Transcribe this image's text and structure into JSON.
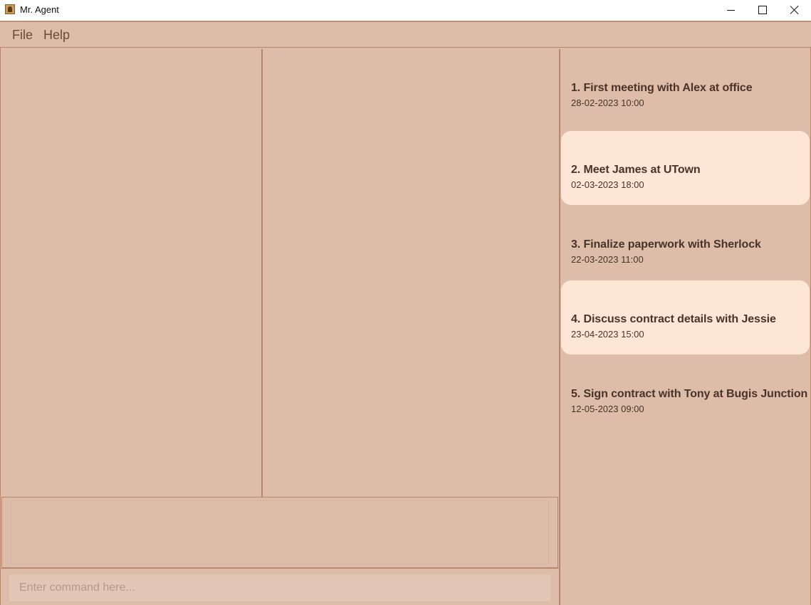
{
  "window": {
    "title": "Mr. Agent",
    "controls": [
      "minimize",
      "maximize",
      "close"
    ]
  },
  "menu": {
    "items": [
      {
        "label": "File"
      },
      {
        "label": "Help"
      }
    ]
  },
  "command_box": {
    "placeholder": "Enter command here...",
    "value": ""
  },
  "result_display": {
    "text": ""
  },
  "events": [
    {
      "title": "1. First meeting with Alex at office",
      "datetime": "28-02-2023 10:00",
      "highlighted": false
    },
    {
      "title": "2. Meet James at UTown",
      "datetime": "02-03-2023 18:00",
      "highlighted": true
    },
    {
      "title": "3. Finalize paperwork with Sherlock",
      "datetime": "22-03-2023 11:00",
      "highlighted": false
    },
    {
      "title": "4. Discuss contract details with Jessie",
      "datetime": "23-04-2023 15:00",
      "highlighted": true
    },
    {
      "title": "5. Sign contract with Tony at Bugis Junction",
      "datetime": "12-05-2023 09:00",
      "highlighted": false
    }
  ],
  "colors": {
    "background": "#ddbda9",
    "highlight_card": "#fee6d6",
    "border": "#b8866b",
    "text": "#4a3326"
  }
}
